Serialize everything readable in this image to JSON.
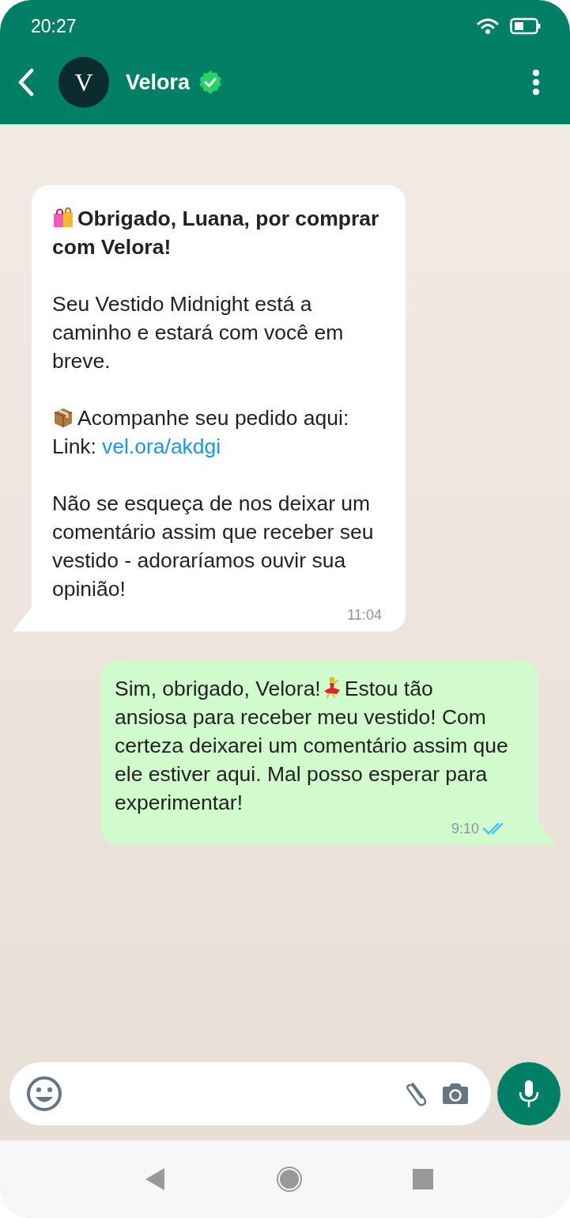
{
  "status_bar": {
    "time": "20:27"
  },
  "header": {
    "avatar_letter": "V",
    "name": "Velora",
    "verified": true
  },
  "messages": [
    {
      "kind": "received",
      "time": "11:04",
      "parts": [
        {
          "kind": "heading",
          "text": "Obrigado, Luana, por comprar com Velora!"
        },
        {
          "kind": "text",
          "text": "Seu Vestido Midnight está a caminho e estará com você em breve."
        },
        {
          "kind": "track",
          "text": "Acompanhe seu pedido aqui:",
          "link_label": "Link:",
          "link": "vel.ora/akdgi"
        },
        {
          "kind": "text",
          "text": "Não se esqueça de nos deixar um comentário assim que receber seu vestido - adoraríamos ouvir sua opinião!"
        }
      ]
    },
    {
      "kind": "sent",
      "time": "9:10",
      "read": true,
      "text_before": "Sim, obrigado, Velora!",
      "text_after": "Estou tão ansiosa para receber meu vestido! Com certeza deixarei um comentário assim que ele estiver aqui. Mal posso esperar para experimentar!"
    }
  ]
}
